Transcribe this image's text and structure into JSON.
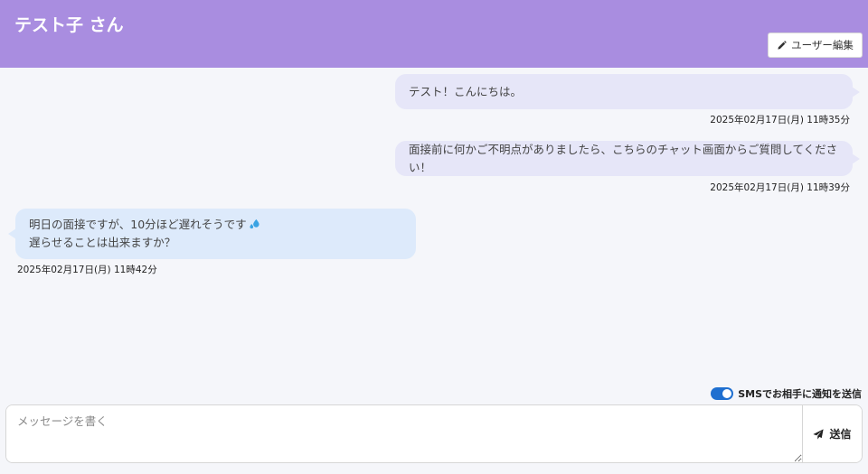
{
  "header": {
    "title": "テスト子 さん",
    "edit_user_label": "ユーザー編集"
  },
  "messages": [
    {
      "direction": "sent",
      "text": "テスト！こんにちは。",
      "timestamp": "2025年02月17日(月) 11時35分"
    },
    {
      "direction": "sent",
      "text": "面接前に何かご不明点がありましたら、こちらのチャット画面からご質問してください！",
      "timestamp": "2025年02月17日(月) 11時39分"
    },
    {
      "direction": "received",
      "line1": "明日の面接ですが、10分ほど遅れそうです",
      "line2": "遅らせることは出来ますか？",
      "emoji": "sweat-droplets-icon",
      "timestamp": "2025年02月17日(月) 11時42分"
    }
  ],
  "sms": {
    "label": "SMSでお相手に通知を送信",
    "enabled": true
  },
  "composer": {
    "placeholder": "メッセージを書く",
    "value": "",
    "send_label": "送信"
  },
  "colors": {
    "header": "#a98de0",
    "sent_bubble": "#e6e6f8",
    "received_bubble": "#ddeafb",
    "toggle_on": "#1f6fd0"
  }
}
